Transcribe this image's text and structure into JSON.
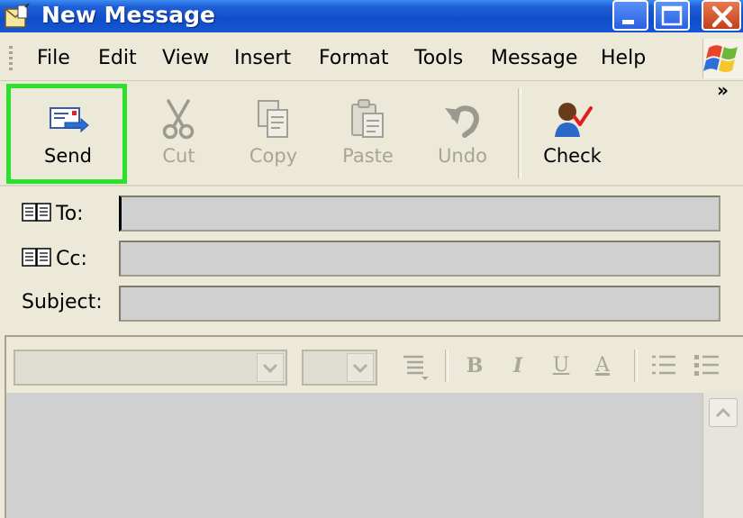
{
  "window": {
    "title": "New Message"
  },
  "menu": [
    "File",
    "Edit",
    "View",
    "Insert",
    "Format",
    "Tools",
    "Message",
    "Help"
  ],
  "toolbar": {
    "send": "Send",
    "cut": "Cut",
    "copy": "Copy",
    "paste": "Paste",
    "undo": "Undo",
    "check": "Check",
    "overflow": "»"
  },
  "fields": {
    "to_label": "To:",
    "cc_label": "Cc:",
    "subject_label": "Subject:",
    "to_value": "",
    "cc_value": "",
    "subject_value": ""
  },
  "format_toolbar": {
    "bold": "B",
    "italic": "I",
    "underline": "U",
    "font_color": "A"
  },
  "colors": {
    "highlight": "#2ce12c",
    "titlebar": "#0f4ec9",
    "field_bg": "#d0d0d0"
  },
  "icons": [
    "app-icon",
    "minimize-icon",
    "maximize-icon",
    "close-icon",
    "windows-logo-icon",
    "send-icon",
    "scissors-icon",
    "copy-icon",
    "paste-icon",
    "undo-icon",
    "check-names-icon",
    "address-book-icon",
    "align-icon",
    "numbered-list-icon",
    "bullet-list-icon",
    "scroll-up-icon"
  ]
}
